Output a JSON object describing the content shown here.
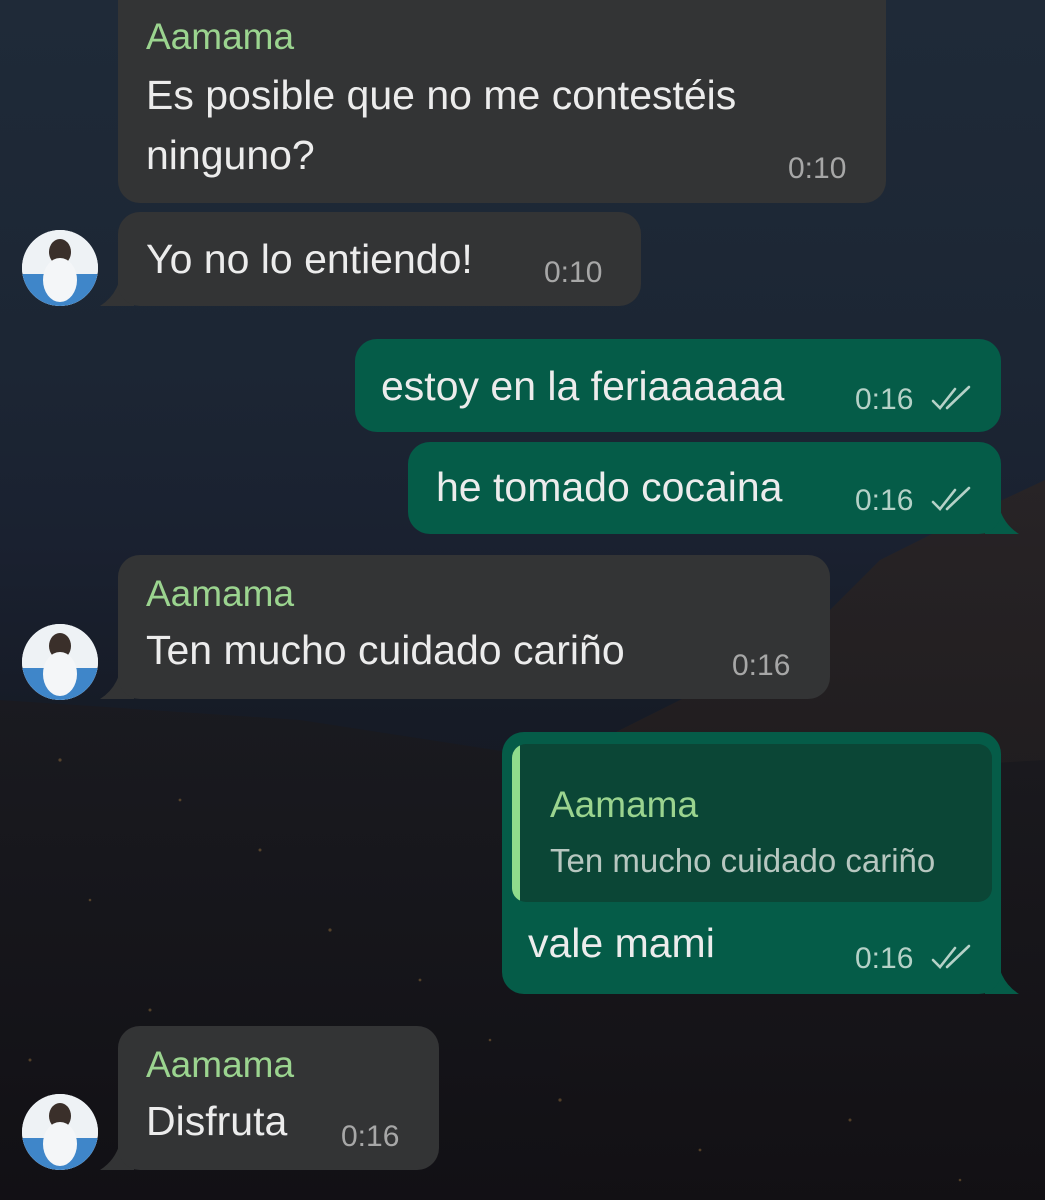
{
  "messages": [
    {
      "sender": "Aamama",
      "text_lines": [
        "Es posible que no me contestéis",
        "ninguno?"
      ],
      "time": "0:10"
    },
    {
      "text": "Yo no lo entiendo!",
      "time": "0:10"
    },
    {
      "text": "estoy en la feriaaaaaa",
      "time": "0:16"
    },
    {
      "text": "he tomado cocaina",
      "time": "0:16"
    },
    {
      "sender": "Aamama",
      "text": "Ten mucho cuidado cariño",
      "time": "0:16"
    },
    {
      "reply_to": {
        "sender": "Aamama",
        "text": "Ten mucho cuidado cariño"
      },
      "text": "vale mami",
      "time": "0:16"
    },
    {
      "sender": "Aamama",
      "text": "Disfruta",
      "time": "0:16"
    }
  ],
  "colors": {
    "incoming_bubble": "#333435",
    "outgoing_bubble": "#055c48",
    "sender_name": "#9bd48f",
    "message_text": "#ececec"
  },
  "icons": [
    "avatar",
    "double-check-icon"
  ]
}
